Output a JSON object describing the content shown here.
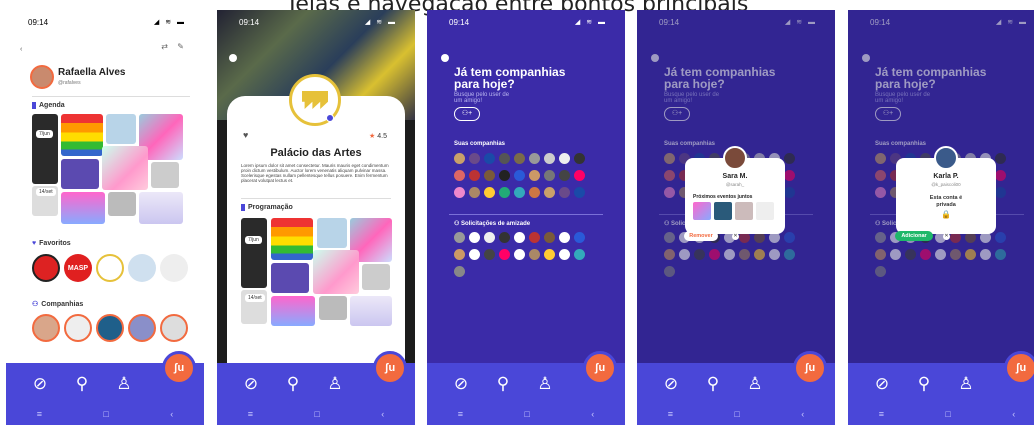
{
  "title": "Telas e navegação entre pontos principais",
  "status": {
    "time": "09:14",
    "icons": "◢ ≋ ▬"
  },
  "nav": {
    "explore": "⊘",
    "search": "⚲",
    "profile": "♙",
    "fab": "ʃu"
  },
  "sys": {
    "menu": "≡",
    "home": "□",
    "back": "‹"
  },
  "profile": {
    "name": "Rafaella Alves",
    "handle": "@rafalves",
    "agenda": "Agenda",
    "date1": "7/jun",
    "date2": "14/set",
    "favoritos": "Favoritos",
    "companhias": "Companhias",
    "masp": "MASP"
  },
  "venue": {
    "name": "Palácio das Artes",
    "rating": "4.5",
    "desc": "Lorem ipsum dolor sit amet consectetur. Mauris mauris eget condimentum proin dictum vestibulum. Auctor lorem venenatis aliquam pulvinar massa. Scelerisque egestas nullam pellentesque tellus posuere. Enim fermentum placerat volutpat lectus et.",
    "programacao": "Programação",
    "date1": "7/jun",
    "date2": "14/set"
  },
  "friends": {
    "headline1": "Já tem companhias",
    "headline2": "para hoje?",
    "sub1": "Busque pelo user de",
    "sub2": "um amigo!",
    "suas": "Suas companhias",
    "solicitacoes": "Solicitações de amizade"
  },
  "popup1": {
    "name": "Sara M.",
    "handle": "@sarah_",
    "eventos": "Próximos eventos juntos",
    "remover": "Remover"
  },
  "popup2": {
    "name": "Karla P.",
    "handle": "@k_paiscoli00",
    "privada1": "Esta conta é",
    "privada2": "privada",
    "adicionar": "Adicionar"
  }
}
